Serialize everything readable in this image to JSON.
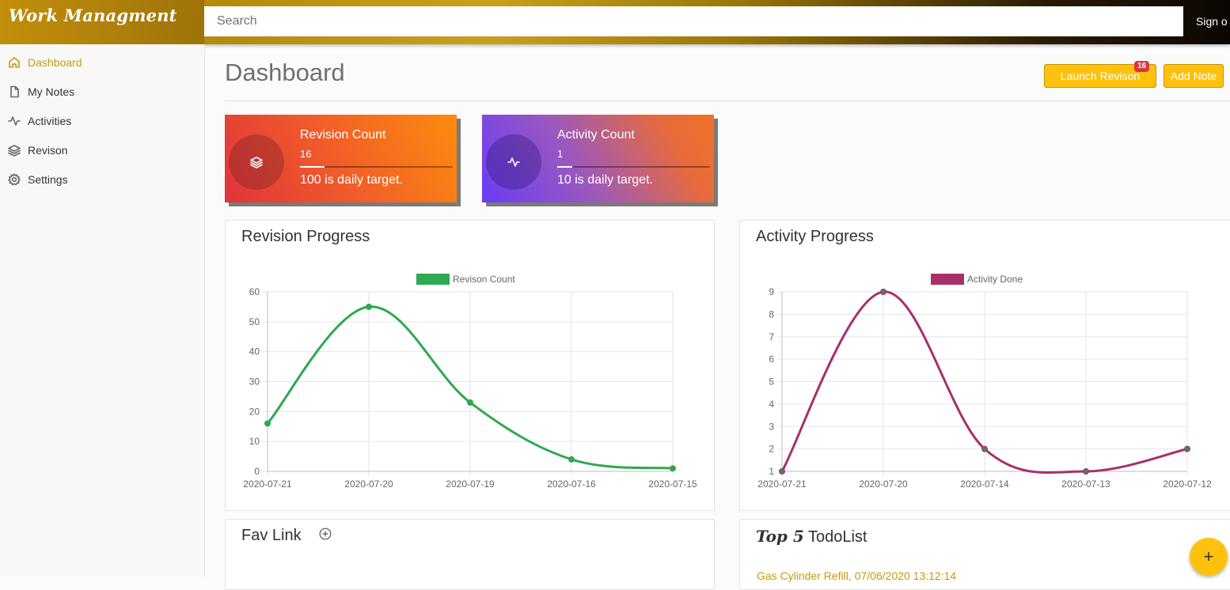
{
  "app": {
    "brand": "Work Managment"
  },
  "topbar": {
    "search_placeholder": "Search",
    "signout_label": "Sign o"
  },
  "sidebar": {
    "items": [
      {
        "label": "Dashboard",
        "icon": "home-icon",
        "active": true
      },
      {
        "label": "My Notes",
        "icon": "file-icon",
        "active": false
      },
      {
        "label": "Activities",
        "icon": "activity-icon",
        "active": false
      },
      {
        "label": "Revison",
        "icon": "layers-icon",
        "active": false
      },
      {
        "label": "Settings",
        "icon": "gear-icon",
        "active": false
      }
    ]
  },
  "header": {
    "title": "Dashboard",
    "launch_label": "Launch Revison",
    "launch_badge": "16",
    "add_note_label": "Add Note"
  },
  "stats": {
    "revision": {
      "label": "Revision Count",
      "value": "16",
      "target_text": "100 is daily target.",
      "progress": 0.16
    },
    "activity": {
      "label": "Activity Count",
      "value": "1",
      "target_text": "10 is daily target.",
      "progress": 0.1
    }
  },
  "panels": {
    "revision_title": "Revision Progress",
    "activity_title": "Activity Progress",
    "fav_title": "Fav Link",
    "todo_title_em": "Top 5",
    "todo_title_rest": " TodoList",
    "todo_first_item": "Gas Cylinder Refill, 07/06/2020 13:12:14"
  },
  "colors": {
    "accent": "#fec10e",
    "revision_line": "#2fa84f",
    "activity_line": "#a8306a",
    "badge": "#dc3545"
  },
  "fab_label": "+",
  "chart_data": [
    {
      "type": "line",
      "title": "Revision Progress",
      "categories": [
        "2020-07-21",
        "2020-07-20",
        "2020-07-19",
        "2020-07-16",
        "2020-07-15"
      ],
      "series": [
        {
          "name": "Revison Count",
          "values": [
            16,
            55,
            23,
            4,
            1
          ]
        }
      ],
      "ylim": [
        0,
        60
      ],
      "yticks": [
        0,
        10,
        20,
        30,
        40,
        50,
        60
      ],
      "legend": "top",
      "grid": true
    },
    {
      "type": "line",
      "title": "Activity Progress",
      "categories": [
        "2020-07-21",
        "2020-07-20",
        "2020-07-14",
        "2020-07-13",
        "2020-07-12"
      ],
      "series": [
        {
          "name": "Activity Done",
          "values": [
            1,
            9,
            2,
            1,
            2
          ]
        }
      ],
      "ylim": [
        1,
        9
      ],
      "yticks": [
        1,
        2,
        3,
        4,
        5,
        6,
        7,
        8,
        9
      ],
      "legend": "top",
      "grid": true
    }
  ]
}
